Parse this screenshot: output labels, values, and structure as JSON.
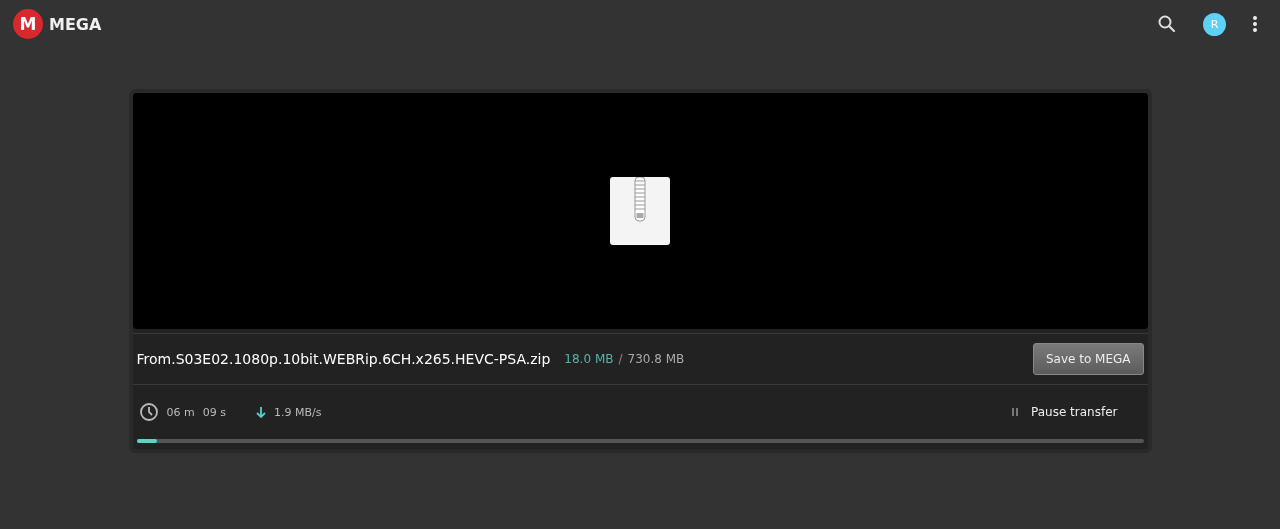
{
  "header": {
    "logo_letter": "M",
    "brand": "MEGA",
    "avatar_letter": "R"
  },
  "transfer": {
    "file_name": "From.S03E02.1080p.10bit.WEBRip.6CH.x265.HEVC-PSA.zip",
    "downloaded": "18.0 MB",
    "separator": "/",
    "total": "730.8 MB",
    "save_button": "Save to MEGA",
    "time_minutes": "06 m",
    "time_seconds": "09 s",
    "speed": "1.9 MB/s",
    "pause_button": "Pause transfer",
    "level": 0.02
  }
}
